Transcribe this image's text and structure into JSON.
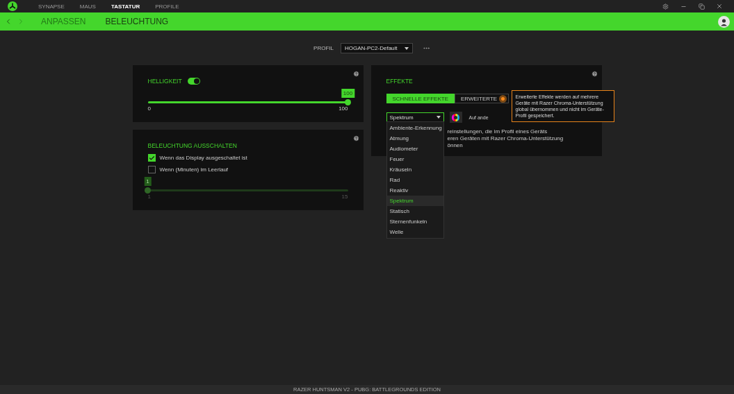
{
  "top_nav": {
    "tabs": [
      {
        "label": "SYNAPSE",
        "selected": false
      },
      {
        "label": "MAUS",
        "selected": false
      },
      {
        "label": "TASTATUR",
        "selected": true
      },
      {
        "label": "PROFILE",
        "selected": false
      }
    ]
  },
  "sub_nav": {
    "tabs": [
      {
        "label": "ANPASSEN",
        "selected": false
      },
      {
        "label": "BELEUCHTUNG",
        "selected": true
      }
    ]
  },
  "profile": {
    "label": "PROFIL",
    "value": "HOGAN-PC2-Default"
  },
  "brightness": {
    "title": "HELLIGKEIT",
    "on": true,
    "level": 1,
    "value": "100",
    "min": "0",
    "max": "100"
  },
  "lighting_off": {
    "title": "BELEUCHTUNG AUSSCHALTEN",
    "options": [
      {
        "label": "Wenn das Display ausgeschaltet ist",
        "checked": true
      },
      {
        "label": "Wenn (Minuten) im Leerlauf",
        "checked": false
      }
    ],
    "slider": {
      "disabled": true,
      "level": 0,
      "value": "1",
      "min": "1",
      "max": "15"
    }
  },
  "effects": {
    "title": "EFFEKTE",
    "tabs": [
      {
        "label": "SCHNELLE EFFEKTE",
        "selected": true
      },
      {
        "label": "ERWEITERTE",
        "selected": false
      }
    ],
    "dropdown": {
      "value": "Spektrum",
      "options": [
        {
          "label": "Ambiente-Erkennung",
          "selected": false
        },
        {
          "label": "Atmung",
          "selected": false
        },
        {
          "label": "Audiometer",
          "selected": false
        },
        {
          "label": "Feuer",
          "selected": false
        },
        {
          "label": "Kräuseln",
          "selected": false
        },
        {
          "label": "Rad",
          "selected": false
        },
        {
          "label": "Reaktiv",
          "selected": false
        },
        {
          "label": "Spektrum",
          "selected": true
        },
        {
          "label": "Statisch",
          "selected": false
        },
        {
          "label": "Sternenfunkeln",
          "selected": false
        },
        {
          "label": "Welle",
          "selected": false
        }
      ]
    },
    "apply_label": "Auf ande",
    "description": [
      "reinstellungen, die im Profil eines Geräts",
      "eren Geräten mit Razer Chroma-Unterstützung",
      "önnen"
    ],
    "tooltip": "Erweiterte Effekte werden auf mehrere Geräte mit Razer Chroma-Unterstützung global übernommen und nicht im Geräte-Profil gespeichert."
  },
  "status_bar": "RAZER HUNTSMAN V2 - PUBG: BATTLEGROUNDS EDITION"
}
